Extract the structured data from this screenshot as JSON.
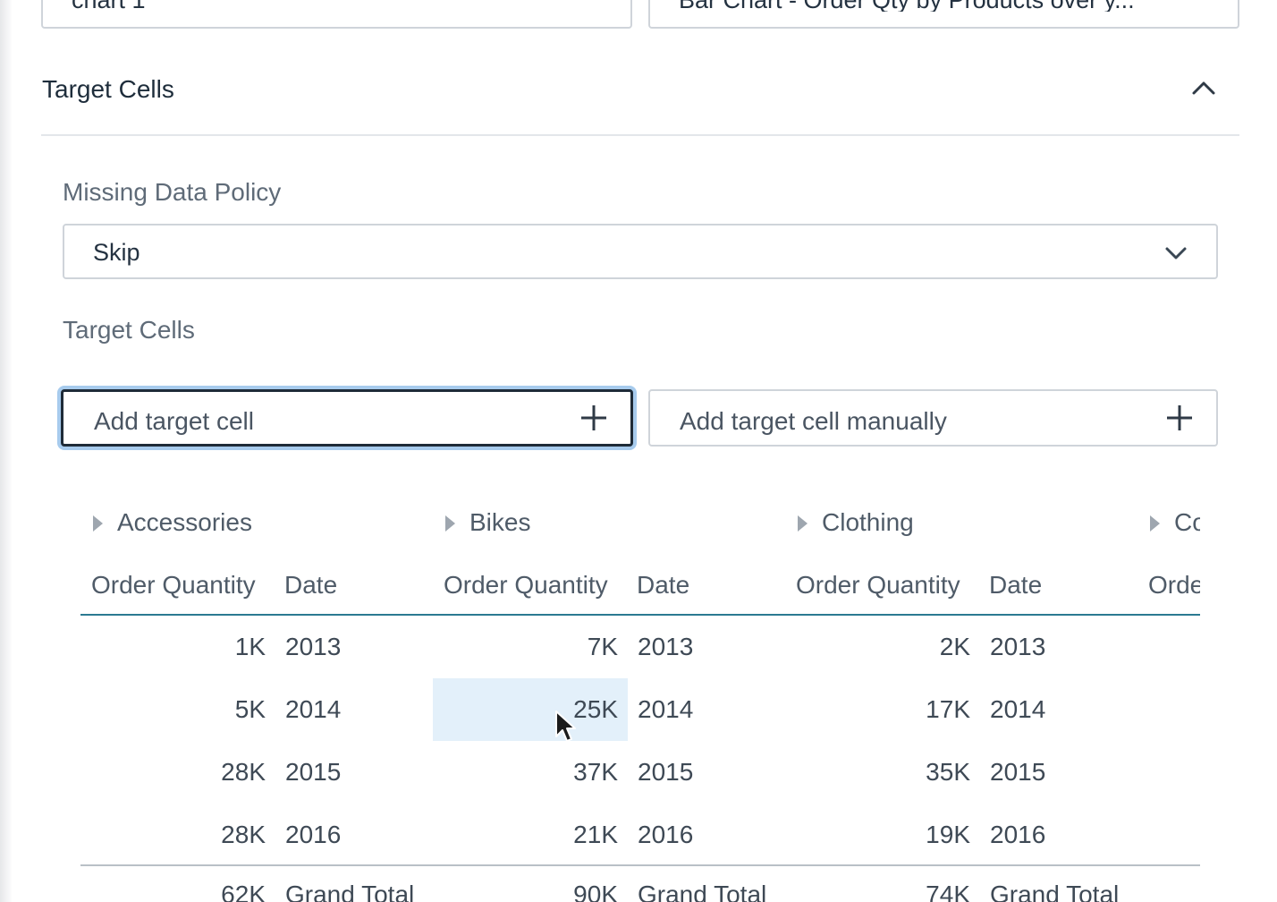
{
  "top_selects": {
    "chart_value": "chart 1",
    "visual_value": "Bar Chart - Order Qty by Products over y..."
  },
  "section": {
    "title": "Target Cells"
  },
  "missing_data_policy": {
    "label": "Missing Data Policy",
    "value": "Skip"
  },
  "target_cells": {
    "label": "Target Cells",
    "add_placeholder": "Add target cell",
    "add_manual_placeholder": "Add target cell manually"
  },
  "table": {
    "groups": [
      "Accessories",
      "Bikes",
      "Clothing",
      "Co"
    ],
    "column_headers": {
      "quantity": "Order Quantity",
      "date": "Date",
      "partial": "Orde"
    },
    "rows": [
      {
        "values": [
          {
            "qty": "1K",
            "date": "2013"
          },
          {
            "qty": "7K",
            "date": "2013"
          },
          {
            "qty": "2K",
            "date": "2013"
          }
        ]
      },
      {
        "values": [
          {
            "qty": "5K",
            "date": "2014"
          },
          {
            "qty": "25K",
            "date": "2014"
          },
          {
            "qty": "17K",
            "date": "2014"
          }
        ]
      },
      {
        "values": [
          {
            "qty": "28K",
            "date": "2015"
          },
          {
            "qty": "37K",
            "date": "2015"
          },
          {
            "qty": "35K",
            "date": "2015"
          }
        ]
      },
      {
        "values": [
          {
            "qty": "28K",
            "date": "2016"
          },
          {
            "qty": "21K",
            "date": "2016"
          },
          {
            "qty": "19K",
            "date": "2016"
          }
        ]
      }
    ],
    "totals": [
      {
        "qty": "62K",
        "label": "Grand Total"
      },
      {
        "qty": "90K",
        "label": "Grand Total"
      },
      {
        "qty": "74K",
        "label": "Grand Total"
      }
    ]
  },
  "colors": {
    "accent_rule": "#2b7a91",
    "focus_ring": "#a7cbed",
    "cell_highlight": "#e3f0fa"
  },
  "icons": [
    "chevron-down-icon",
    "chevron-up-icon",
    "plus-icon",
    "expand-triangle-icon",
    "mouse-cursor-icon"
  ]
}
